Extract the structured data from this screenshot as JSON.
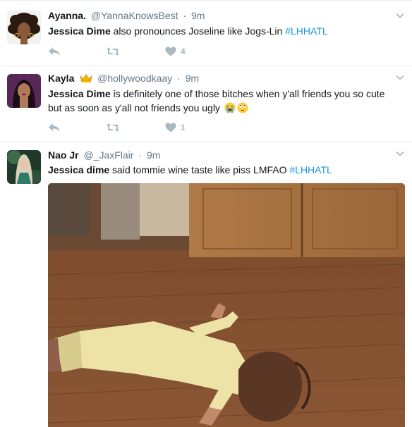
{
  "tweets": [
    {
      "fullname": "Ayanna.",
      "username": "@YannaKnowsBest",
      "separator": "·",
      "time": "9m",
      "mention": "Jessica Dime",
      "text": " also pronounces Joseline like Jogs-Lin ",
      "hashtag": "#LHHATL",
      "like_count": "4"
    },
    {
      "fullname": "Kayla",
      "username": "@hollywoodkaay",
      "separator": "·",
      "time": "9m",
      "mention": "Jessica Dime",
      "text": " is definitely one of those bitches when y'all friends you so cute but as soon as y'all not friends you ugly ",
      "like_count": "1"
    },
    {
      "fullname": "Nao Jr",
      "username": "@_JaxFlair",
      "separator": "·",
      "time": "9m",
      "mention": "Jessica dime",
      "text": " said tommie wine taste like piss LMFAO ",
      "hashtag": "#LHHATL"
    }
  ],
  "icons": {
    "reply": "reply-icon",
    "retweet": "retweet-icon",
    "like": "heart-icon",
    "caret": "chevron-down-icon",
    "crown": "crown-icon",
    "emoji_cry": "loudly-crying-face-icon",
    "emoji_eyeroll": "face-with-rolling-eyes-icon"
  },
  "colors": {
    "link": "#1b95e0",
    "secondary_text": "#657786",
    "action_gray": "#aab8c2",
    "divider": "#e6ecf0"
  }
}
